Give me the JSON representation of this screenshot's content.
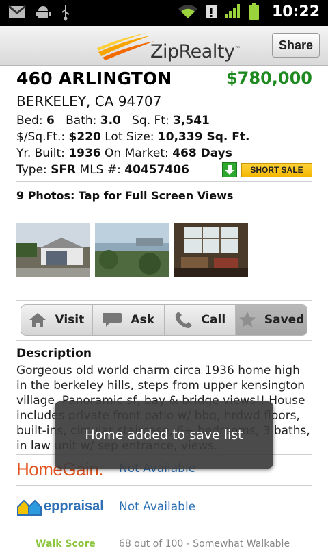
{
  "status_bar": {
    "time": "10:22",
    "icons": [
      "gmail-icon",
      "android-debug-icon",
      "usb-icon",
      "wifi-icon",
      "alert-icon",
      "signal-icon",
      "battery-icon"
    ]
  },
  "header": {
    "logo_text": "ZipRealty",
    "logo_tm": "™",
    "share_label": "Share"
  },
  "listing": {
    "address": "460 ARLINGTON",
    "price": "$780,000",
    "city": "BERKELEY, CA 94707",
    "bed_label": "Bed:",
    "bed": "6",
    "bath_label": "Bath:",
    "bath": "3.0",
    "sqft_label": "Sq. Ft:",
    "sqft": "3,541",
    "ppsf_label": "$/Sq.Ft.:",
    "ppsf": "$220",
    "lot_label": "Lot Size:",
    "lot": "10,339 Sq. Ft.",
    "built_label": "Yr. Built:",
    "built": "1936",
    "market_label": "On Market:",
    "market": "468 Days",
    "type_label": "Type:",
    "type": "SFR",
    "mls_label": "MLS #:",
    "mls": "40457406",
    "short_sale": "SHORT SALE"
  },
  "photos": {
    "title": "9 Photos: Tap for Full Screen Views"
  },
  "actions": {
    "visit": "Visit",
    "ask": "Ask",
    "call": "Call",
    "saved": "Saved"
  },
  "description": {
    "title": "Description",
    "text": "Gorgeous old world charm circa 1936 home high in the berkeley hills, steps from upper kensington village. Panoramic sf, bay & bridge views!! House includes private front patio w/ bbq, hrdwd floors, built-ins, circular staircase, 6+ bedrooms, 3 baths, in law unit w/ sep entrance, views."
  },
  "external": {
    "homegain_logo": "HomeGain.",
    "homegain_value": "Not Available",
    "eppraisal_logo": "eppraisal",
    "eppraisal_value": "Not Available",
    "walkscore_logo": "Walk Score",
    "walkscore_value": "68 out of 100 - Somewhat Walkable"
  },
  "toast": {
    "message": "Home added to save list"
  },
  "colors": {
    "price_green": "#1f8a1f",
    "short_sale_yellow": "#f3b600",
    "link_blue": "#2c6fb5",
    "homegain_orange": "#e0531f"
  }
}
